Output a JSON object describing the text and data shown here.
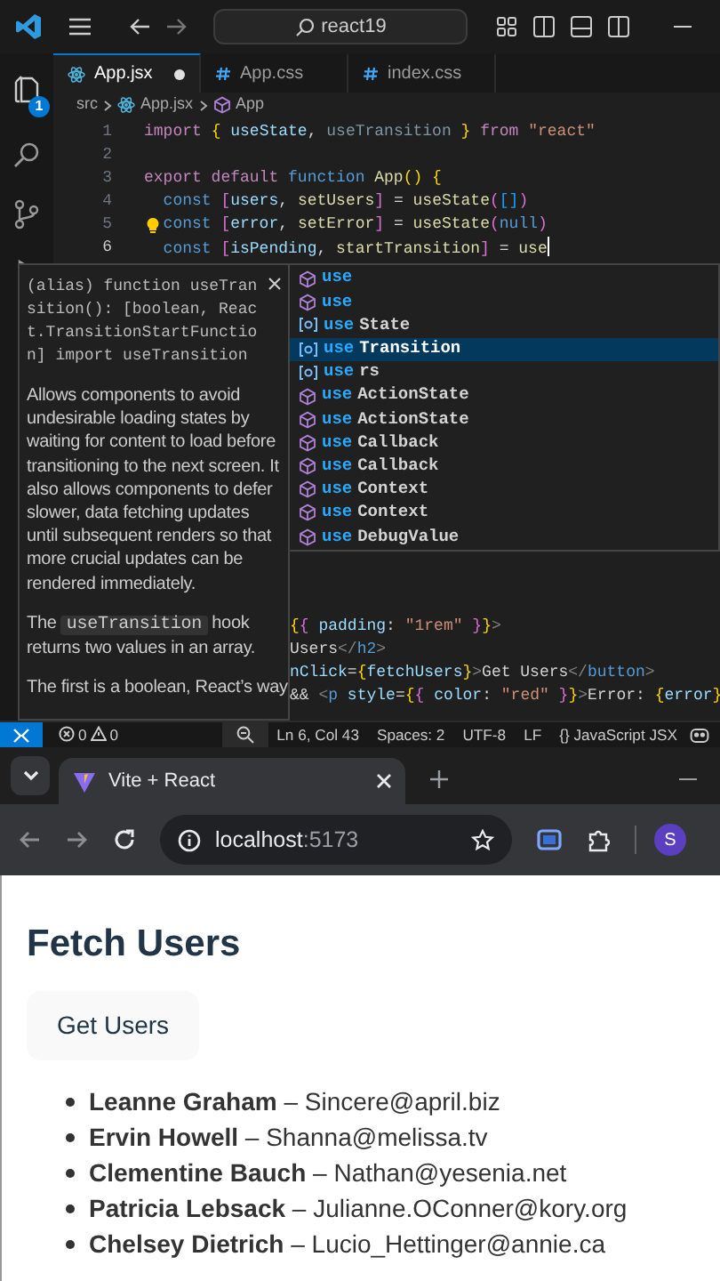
{
  "title_bar": {
    "search": "react19"
  },
  "activity_bar": {
    "explorer_badge": "1"
  },
  "tabs": [
    {
      "label": "App.jsx",
      "kind": "react",
      "selected": true,
      "modified": true
    },
    {
      "label": "App.css",
      "kind": "css",
      "selected": false,
      "modified": false
    },
    {
      "label": "index.css",
      "kind": "css",
      "selected": false,
      "modified": false
    }
  ],
  "breadcrumb": [
    {
      "label": "src",
      "kind": "folder"
    },
    {
      "label": "App.jsx",
      "kind": "react"
    },
    {
      "label": "App",
      "kind": "component"
    }
  ],
  "code_lines": [
    {
      "number": "1",
      "current": false,
      "lightbulb": false,
      "tokens": [
        {
          "kind": "control",
          "text": "import "
        },
        {
          "kind": "b1",
          "text": "{"
        },
        {
          "kind": "var",
          "text": " useState"
        },
        {
          "kind": "text",
          "text": ", "
        },
        {
          "kind": "unused",
          "text": "useTransition "
        },
        {
          "kind": "b1",
          "text": "} "
        },
        {
          "kind": "control",
          "text": "from "
        },
        {
          "kind": "str",
          "text": "\"react\""
        }
      ]
    },
    {
      "number": "2",
      "current": false,
      "lightbulb": false
    },
    {
      "number": "3",
      "current": false,
      "lightbulb": false,
      "tokens": [
        {
          "kind": "control",
          "text": "export default "
        },
        {
          "kind": "storage",
          "text": "function "
        },
        {
          "kind": "fn",
          "text": "App"
        },
        {
          "kind": "b1",
          "text": "() {"
        }
      ],
      "children": [
        {
          "number": "4",
          "current": false,
          "lightbulb": false,
          "tokens": [
            {
              "kind": "storage",
              "text": "const "
            },
            {
              "kind": "b2",
              "text": "["
            },
            {
              "kind": "var",
              "text": "users"
            },
            {
              "kind": "text",
              "text": ", "
            },
            {
              "kind": "fn",
              "text": "setUsers"
            },
            {
              "kind": "b2",
              "text": "]"
            },
            {
              "kind": "text",
              "text": " = "
            },
            {
              "kind": "fn",
              "text": "useState"
            },
            {
              "kind": "b2",
              "text": "("
            },
            {
              "kind": "b3",
              "text": "[]"
            },
            {
              "kind": "b2",
              "text": ")"
            }
          ]
        },
        {
          "number": "5",
          "current": false,
          "lightbulb": true,
          "tokens": [
            {
              "kind": "storage",
              "text": "const "
            },
            {
              "kind": "b2",
              "text": "["
            },
            {
              "kind": "var",
              "text": "error"
            },
            {
              "kind": "text",
              "text": ", "
            },
            {
              "kind": "fn",
              "text": "setError"
            },
            {
              "kind": "b2",
              "text": "]"
            },
            {
              "kind": "text",
              "text": " = "
            },
            {
              "kind": "fn",
              "text": "useState"
            },
            {
              "kind": "b2",
              "text": "("
            },
            {
              "kind": "storage",
              "text": "null"
            },
            {
              "kind": "b2",
              "text": ")"
            }
          ]
        },
        {
          "number": "6",
          "current": true,
          "lightbulb": false,
          "tokens": [
            {
              "kind": "storage",
              "text": "const "
            },
            {
              "kind": "b2",
              "text": "["
            },
            {
              "kind": "var",
              "text": "isPending"
            },
            {
              "kind": "text",
              "text": ", "
            },
            {
              "kind": "fn",
              "text": "startTransition"
            },
            {
              "kind": "b2",
              "text": "]"
            },
            {
              "kind": "text",
              "text": " = "
            },
            {
              "kind": "fn",
              "text": "use"
            }
          ]
        }
      ]
    }
  ],
  "code_fragments": [
    {
      "tokens": [
        {
          "kind": "b1",
          "text": "{"
        },
        {
          "kind": "b2",
          "text": "{ "
        },
        {
          "kind": "var",
          "text": "padding"
        },
        {
          "kind": "text",
          "text": ": "
        },
        {
          "kind": "str",
          "text": "\"1rem\""
        },
        {
          "kind": "b2",
          "text": " }"
        },
        {
          "kind": "b1",
          "text": "}"
        },
        {
          "kind": "tagp",
          "text": ">"
        }
      ]
    },
    {
      "tokens": [
        {
          "kind": "text",
          "text": "Users"
        },
        {
          "kind": "tagp",
          "text": "</"
        },
        {
          "kind": "tag",
          "text": "h2"
        },
        {
          "kind": "tagp",
          "text": ">"
        }
      ]
    },
    {
      "tokens": [
        {
          "kind": "attr",
          "text": "nClick"
        },
        {
          "kind": "text",
          "text": "="
        },
        {
          "kind": "b1",
          "text": "{"
        },
        {
          "kind": "var",
          "text": "fetchUsers"
        },
        {
          "kind": "b1",
          "text": "}"
        },
        {
          "kind": "tagp",
          "text": ">"
        },
        {
          "kind": "text",
          "text": "Get Users"
        },
        {
          "kind": "tagp",
          "text": "</"
        },
        {
          "kind": "tag",
          "text": "button"
        },
        {
          "kind": "tagp",
          "text": ">"
        }
      ]
    },
    {
      "tokens": [
        {
          "kind": "text",
          "text": "&& "
        },
        {
          "kind": "tagp",
          "text": "<"
        },
        {
          "kind": "tag",
          "text": "p "
        },
        {
          "kind": "attr",
          "text": "style"
        },
        {
          "kind": "text",
          "text": "="
        },
        {
          "kind": "b1",
          "text": "{"
        },
        {
          "kind": "b2",
          "text": "{ "
        },
        {
          "kind": "var",
          "text": "color"
        },
        {
          "kind": "text",
          "text": ": "
        },
        {
          "kind": "str",
          "text": "\"red\""
        },
        {
          "kind": "b2",
          "text": " }"
        },
        {
          "kind": "b1",
          "text": "}"
        },
        {
          "kind": "tagp",
          "text": ">"
        },
        {
          "kind": "text",
          "text": "Error: "
        },
        {
          "kind": "b1",
          "text": "{"
        },
        {
          "kind": "var",
          "text": "error"
        },
        {
          "kind": "b1",
          "text": "}"
        }
      ]
    }
  ],
  "hover_doc": {
    "signature": "(alias) function useTransition(): [boolean, React.TransitionStartFunction] import useTransition",
    "paragraphs": [
      {
        "kind": "text",
        "text": "Allows components to avoid undesirable loading states by waiting for content to load before transitioning to the next screen. It also allows components to defer slower, data fetching updates until subsequent renders so that more crucial updates can be rendered immediately."
      },
      {
        "kind": "with_code",
        "before": "The",
        "code": "useTransition",
        "after": "hook returns two values in an array."
      },
      {
        "kind": "text",
        "text": "The first is a boolean, React’s way"
      }
    ]
  },
  "suggestions": [
    {
      "match": "use",
      "kind": "function",
      "selected": false
    },
    {
      "match": "use",
      "kind": "function",
      "selected": false
    },
    {
      "match": "use",
      "rest": "State",
      "kind": "variable",
      "selected": false
    },
    {
      "match": "use",
      "rest": "Transition",
      "kind": "variable",
      "selected": true
    },
    {
      "match": "use",
      "rest": "rs",
      "kind": "variable",
      "selected": false
    },
    {
      "match": "use",
      "rest": "ActionState",
      "kind": "function",
      "selected": false
    },
    {
      "match": "use",
      "rest": "ActionState",
      "kind": "function",
      "selected": false
    },
    {
      "match": "use",
      "rest": "Callback",
      "kind": "function",
      "selected": false
    },
    {
      "match": "use",
      "rest": "Callback",
      "kind": "function",
      "selected": false
    },
    {
      "match": "use",
      "rest": "Context",
      "kind": "function",
      "selected": false
    },
    {
      "match": "use",
      "rest": "Context",
      "kind": "function",
      "selected": false
    },
    {
      "match": "use",
      "rest": "DebugValue",
      "kind": "function",
      "selected": false
    }
  ],
  "status_bar": {
    "errors": "0",
    "warnings": "0",
    "position": "Ln 6, Col 43",
    "indent": "Spaces: 2",
    "encoding": "UTF-8",
    "eol": "LF",
    "language_glyph": "{}",
    "language": "JavaScript JSX"
  },
  "browser": {
    "tab_title": "Vite + React",
    "host": "localhost",
    "port": ":5173",
    "profile_initial": "S"
  },
  "page": {
    "heading": "Fetch Users",
    "button": "Get Users",
    "users": [
      {
        "name": "Leanne Graham",
        "separator": "–",
        "email": "Sincere@april.biz"
      },
      {
        "name": "Ervin Howell",
        "separator": "–",
        "email": "Shanna@melissa.tv"
      },
      {
        "name": "Clementine Bauch",
        "separator": "–",
        "email": "Nathan@yesenia.net"
      },
      {
        "name": "Patricia Lebsack",
        "separator": "–",
        "email": "Julianne.OConner@kory.org"
      },
      {
        "name": "Chelsey Dietrich",
        "separator": "–",
        "email": "Lucio_Hettinger@annie.ca"
      }
    ]
  }
}
